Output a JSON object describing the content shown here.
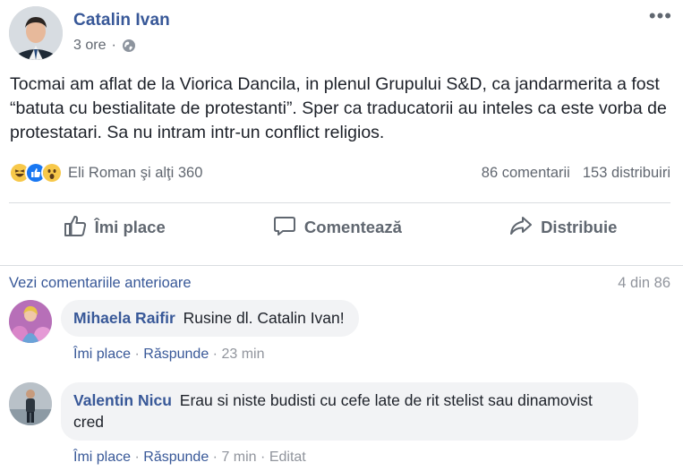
{
  "post": {
    "author": "Catalin Ivan",
    "time": "3 ore",
    "separator": "·",
    "more": "•••",
    "text": "Tocmai am aflat de la Viorica Dancila, in plenul Grupului S&D, ca jandarmerita a fost “batuta cu bestialitate de protestanti”. Sper ca traducatorii au inteles ca este vorba de protestatari. Sa nu intram intr-un conflict religios."
  },
  "reactions": {
    "icons": [
      "haha-icon",
      "like-icon",
      "wow-icon"
    ],
    "summary": "Eli Roman şi alţi 360",
    "comments_count": "86 comentarii",
    "shares_count": "153 distribuiri"
  },
  "actions": {
    "like": "Îmi place",
    "comment": "Comentează",
    "share": "Distribuie"
  },
  "comments_section": {
    "previous_link": "Vezi comentariile anterioare",
    "page_count": "4 din 86",
    "items": [
      {
        "name": "Mihaela Raifir",
        "text": "Rusine dl. Catalin Ivan!",
        "like": "Îmi place",
        "reply": "Răspunde",
        "dot": "·",
        "time": "23 min",
        "edited": ""
      },
      {
        "name": "Valentin Nicu",
        "text": "Erau si niste budisti cu cefe late de rit stelist sau dinamovist cred",
        "like": "Îmi place",
        "reply": "Răspunde",
        "dot": "·",
        "time": "7 min",
        "edited": "Editat"
      }
    ]
  },
  "colors": {
    "link_blue": "#385898",
    "like_blue": "#1877f2",
    "reaction_yellow": "#f7c84a",
    "muted": "#616770",
    "bubble_bg": "#f2f3f5"
  }
}
